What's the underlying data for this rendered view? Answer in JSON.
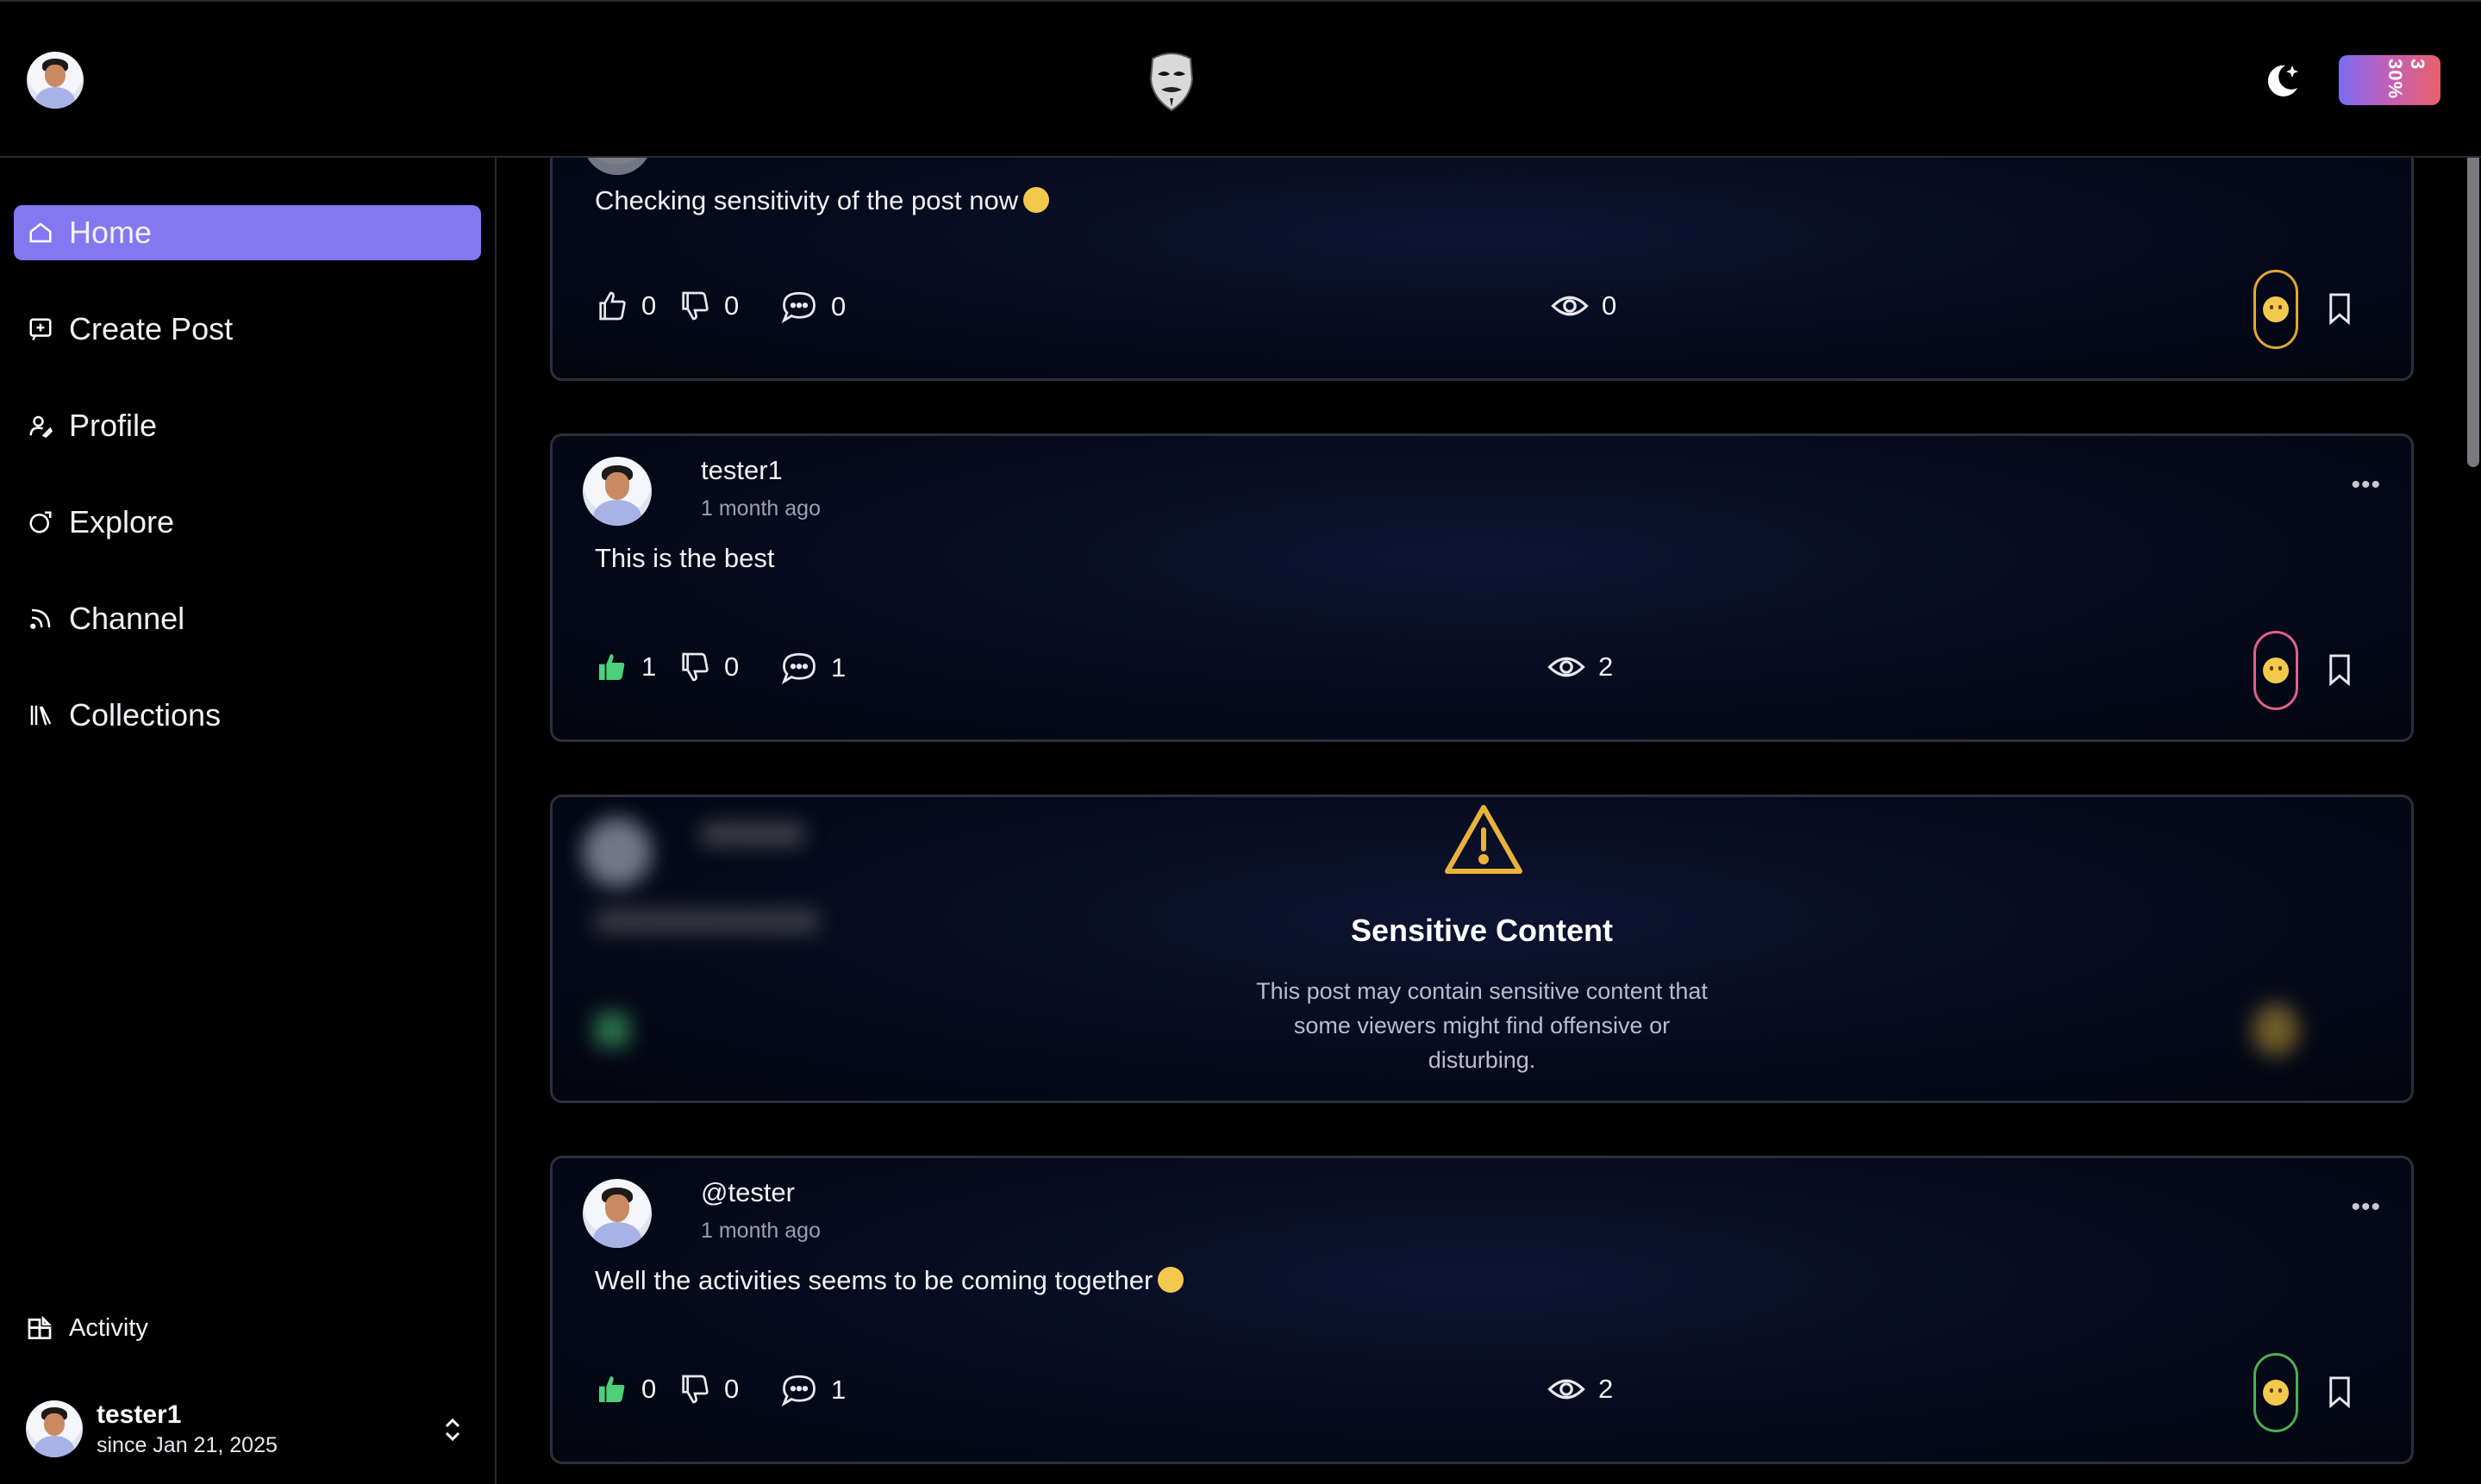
{
  "header": {
    "logo_icon": "anonymous-mask-icon",
    "theme_icon": "moon-star-icon",
    "promo_badge": "3 30%"
  },
  "sidebar": {
    "items": [
      {
        "label": "Home",
        "icon": "home-icon",
        "active": true
      },
      {
        "label": "Create Post",
        "icon": "create-post-icon",
        "active": false
      },
      {
        "label": "Profile",
        "icon": "profile-icon",
        "active": false
      },
      {
        "label": "Explore",
        "icon": "explore-icon",
        "active": false
      },
      {
        "label": "Channel",
        "icon": "rss-icon",
        "active": false
      },
      {
        "label": "Collections",
        "icon": "library-icon",
        "active": false
      }
    ],
    "activity": {
      "label": "Activity",
      "icon": "activity-icon"
    },
    "user": {
      "name": "tester1",
      "since": "since Jan 21, 2025"
    }
  },
  "posts": [
    {
      "text": "Checking sensitivity of the post now",
      "likes": "0",
      "dislikes": "0",
      "comments": "0",
      "views": "0",
      "liked": false,
      "reaction_color": "#e0a82e"
    },
    {
      "user": "tester1",
      "time": "1 month ago",
      "text": "This is the best",
      "likes": "1",
      "dislikes": "0",
      "comments": "1",
      "views": "2",
      "liked": true,
      "reaction_color": "#e0608a"
    },
    {
      "sensitive": true,
      "warning_icon": "warning-triangle-icon",
      "title": "Sensitive Content",
      "description": "This post may contain sensitive content that some viewers might find offensive or disturbing."
    },
    {
      "user": "@tester",
      "time": "1 month ago",
      "text": "Well the activities seems to be coming together",
      "likes": "0",
      "dislikes": "0",
      "comments": "1",
      "views": "2",
      "liked": true,
      "reaction_color": "#4caf50"
    }
  ],
  "colors": {
    "accent": "#8478f0",
    "liked_thumb": "#4cd07a",
    "warning": "#e9b23a"
  }
}
